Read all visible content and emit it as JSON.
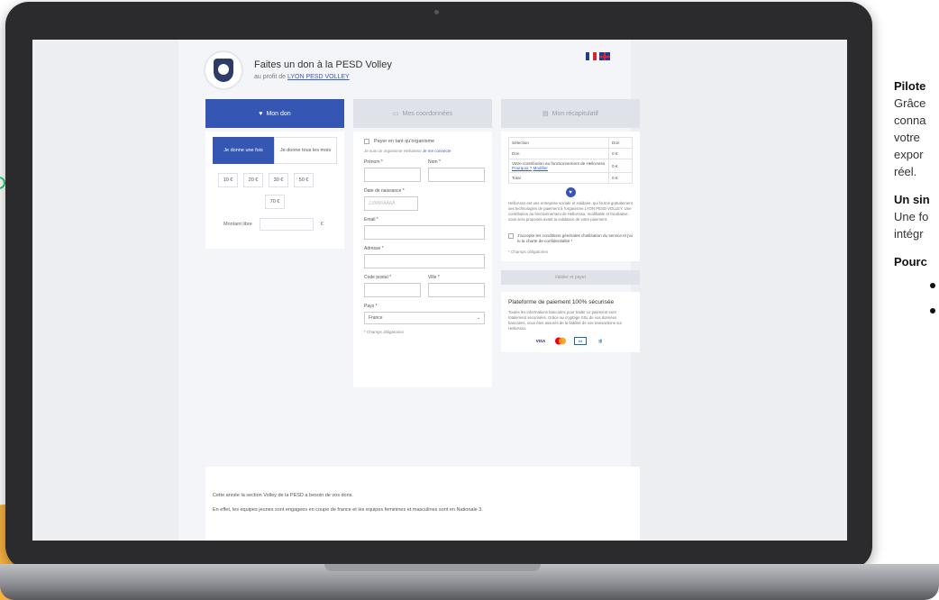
{
  "side": {
    "heading1": "Pilote",
    "lines": [
      "Grâce",
      "conna",
      "votre",
      "expor",
      "réel."
    ],
    "heading2": "Un sin",
    "lines2": [
      "Une fo",
      "intégr"
    ],
    "heading3": "Pourc"
  },
  "header": {
    "title": "Faites un don à la PESD Volley",
    "subtitle_prefix": "au profit de ",
    "subtitle_link": "LYON PESD VOLLEY"
  },
  "tabs": [
    {
      "label": "Mon don",
      "icon": "heart-icon"
    },
    {
      "label": "Mes coordonnées",
      "icon": "id-card-icon"
    },
    {
      "label": "Mon récapitulatif",
      "icon": "list-icon"
    }
  ],
  "donation": {
    "once": "Je donne une fois",
    "monthly": "Je donne tous les mois",
    "amounts": [
      "10 €",
      "20 €",
      "30 €",
      "50 €"
    ],
    "amount_extra": "70 €",
    "free_label": "Montant libre",
    "free_placeholder": "",
    "currency": "€"
  },
  "coords": {
    "org_checkbox": "Payer en tant qu'organisme",
    "note_prefix": "Je suis un organisme Helloasso ",
    "note_link": "Je me connecte",
    "first_name": "Prénom *",
    "last_name": "Nom *",
    "birth": "Date de naissance *",
    "birth_placeholder": "JJ/MM/AAAA",
    "email": "Email *",
    "address": "Adresse *",
    "zip": "Code postal *",
    "city": "Ville *",
    "country": "Pays *",
    "country_value": "France",
    "required": "* Champs obligatoires"
  },
  "recap": {
    "rows": [
      [
        "Sélection",
        "Don"
      ],
      [
        "Don",
        "0 €"
      ],
      [
        "Votre contribution au fonctionnement de HelloAsso",
        "0 €"
      ],
      [
        "Total",
        "0 €"
      ]
    ],
    "why": "Pourquoi ?",
    "edit": "Modifier",
    "paragraph": "HelloAsso est une entreprise sociale et solidaire, qui fournit gratuitement ses technologies de paiement à l'organisme LYON PESD VOLLEY. Une contribution au fonctionnement de HelloAsso, modifiable et facultative, vous sera proposée avant la validation de votre paiement.",
    "cgu": "J'accepte les conditions générales d'utilisation du service et j'ai lu la charte de confidentialité *",
    "required": "* Champs obligatoires",
    "validate": "Valider et payer",
    "secure_title": "Plateforme de paiement 100% sécurisée",
    "secure_text": "Toutes les informations bancaires pour traiter ce paiement sont totalement sécurisées. Grâce au cryptage SSL de vos données bancaires, vous êtes assurés de la fiabilité de vos transactions sur HelloAsso.",
    "cards": [
      "VISA",
      "MC",
      "CB",
      "AMEX"
    ]
  },
  "bottom": {
    "line1": "Cette année la section Volley de la PESD a besoin de vos dons.",
    "line2": "En effet, les equipes jeunes sont engagees en coupe de france et les equipes feminines et masculines sont en Nationale 3."
  },
  "colors": {
    "accent": "#3557b3",
    "link": "#3a5bbf"
  }
}
